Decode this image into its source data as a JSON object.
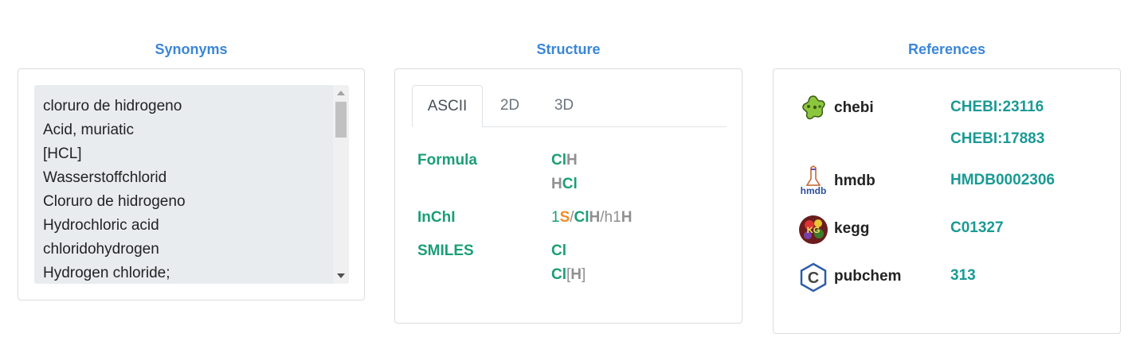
{
  "synonyms": {
    "title": "Synonyms",
    "items": [
      "cloruro de hidrogeno",
      "Acid, muriatic",
      "[HCL]",
      "Wasserstoffchlorid",
      "Cloruro de hidrogeno",
      "Hydrochloric acid",
      "chloridohydrogen",
      "Hydrogen chloride;"
    ]
  },
  "structure": {
    "title": "Structure",
    "tabs": [
      {
        "label": "ASCII",
        "active": true
      },
      {
        "label": "2D",
        "active": false
      },
      {
        "label": "3D",
        "active": false
      }
    ],
    "formula_label": "Formula",
    "formula_values": [
      "ClH",
      "HCl"
    ],
    "inchi_label": "InChI",
    "inchi_value": "1S/ClH/h1H",
    "smiles_label": "SMILES",
    "smiles_values": [
      "Cl",
      "Cl[H]"
    ]
  },
  "references": {
    "title": "References",
    "items": [
      {
        "name": "chebi",
        "icon": "chebi-logo-icon",
        "ids": [
          "CHEBI:23116",
          "CHEBI:17883"
        ]
      },
      {
        "name": "hmdb",
        "icon": "hmdb-logo-icon",
        "ids": [
          "HMDB0002306"
        ]
      },
      {
        "name": "kegg",
        "icon": "kegg-logo-icon",
        "ids": [
          "C01327"
        ]
      },
      {
        "name": "pubchem",
        "icon": "pubchem-logo-icon",
        "ids": [
          "313"
        ]
      }
    ]
  },
  "colors": {
    "title_blue": "#3b86d8",
    "label_green": "#1b9e77",
    "element_grey": "#909090",
    "element_orange": "#f08c2a",
    "link_teal": "#1a9a94"
  }
}
